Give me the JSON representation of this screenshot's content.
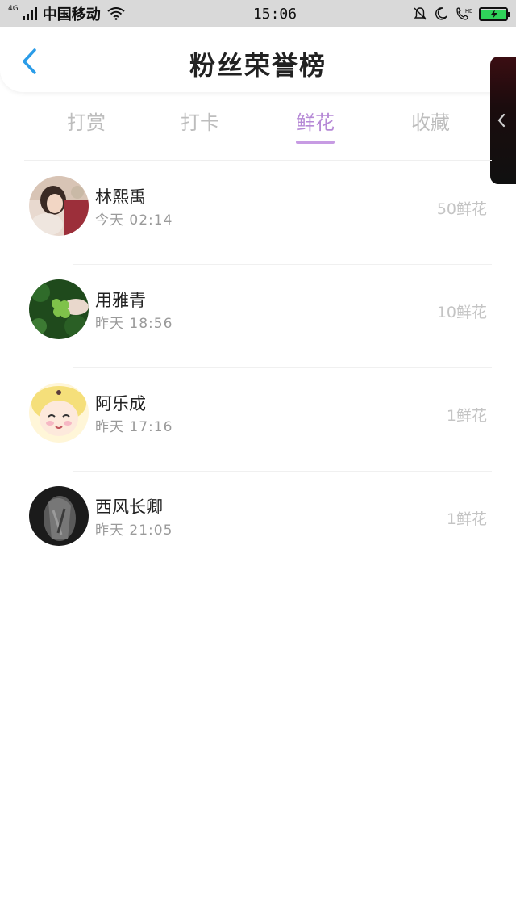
{
  "status_bar": {
    "network_type": "4G",
    "carrier": "中国移动",
    "time": "15:06"
  },
  "header": {
    "title": "粉丝荣誉榜"
  },
  "tabs": [
    {
      "label": "打赏",
      "active": false
    },
    {
      "label": "打卡",
      "active": false
    },
    {
      "label": "鲜花",
      "active": true
    },
    {
      "label": "收藏",
      "active": false
    }
  ],
  "fans": [
    {
      "name": "林熙禹",
      "time": "今天 02:14",
      "amount": "50鲜花"
    },
    {
      "name": "用雅青",
      "time": "昨天 18:56",
      "amount": "10鲜花"
    },
    {
      "name": "阿乐成",
      "time": "昨天 17:16",
      "amount": "1鲜花"
    },
    {
      "name": "西风长卿",
      "time": "昨天 21:05",
      "amount": "1鲜花"
    }
  ],
  "colors": {
    "accent": "#b689d6",
    "back_arrow": "#2a9ce8",
    "muted_text": "#bdbdbd"
  }
}
